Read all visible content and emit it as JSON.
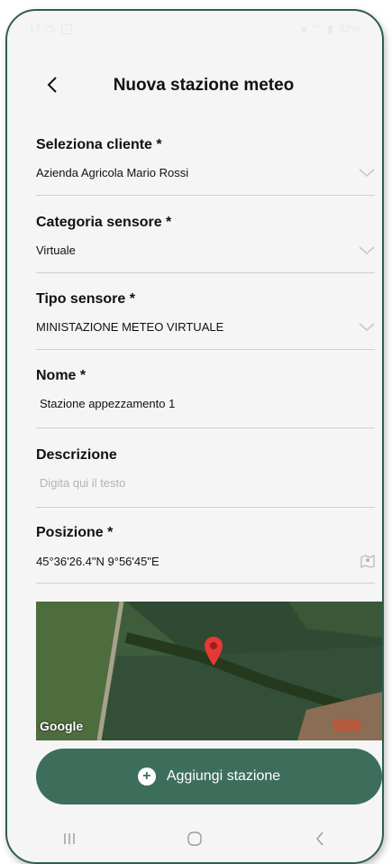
{
  "status_bar": {
    "time": "17:25",
    "battery": "32%"
  },
  "header": {
    "title": "Nuova stazione meteo"
  },
  "fields": [
    {
      "label": "Seleziona cliente *",
      "value": "Azienda Agricola Mario Rossi"
    },
    {
      "label": "Categoria sensore *",
      "value": "Virtuale"
    },
    {
      "label": "Tipo sensore *",
      "value": "MINISTAZIONE METEO VIRTUALE"
    },
    {
      "label": "Nome *",
      "value": "Stazione appezzamento 1"
    },
    {
      "label": "Descrizione",
      "placeholder": "Digita qui il testo"
    },
    {
      "label": "Posizione *",
      "value": "45°36'26.4\"N 9°56'45\"E"
    }
  ],
  "map": {
    "attribution": "Google"
  },
  "add_button": {
    "label": "Aggiungi stazione"
  },
  "colors": {
    "accent": "#3d6e5c",
    "pin": "#e53935"
  }
}
